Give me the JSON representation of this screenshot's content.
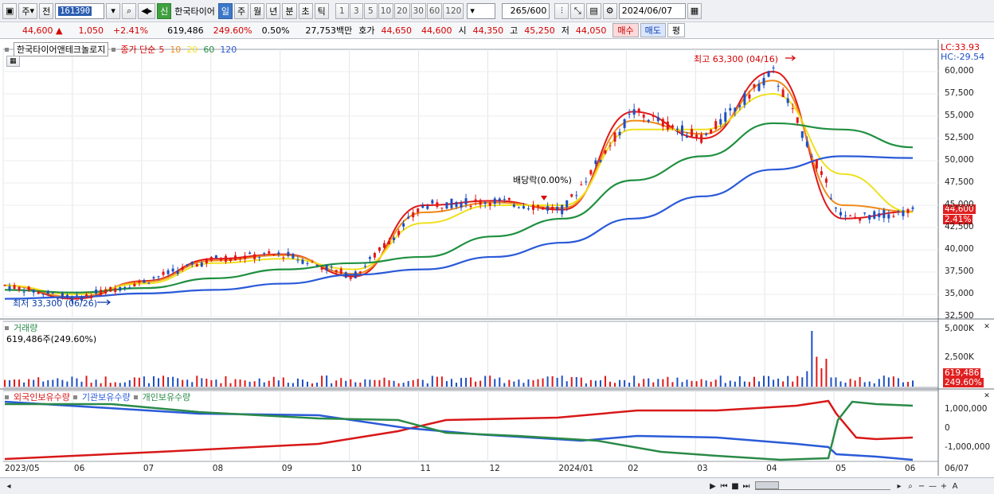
{
  "toolbar": {
    "period_unit": "주",
    "prev_label": "전",
    "code": "161390",
    "shin_label": "신",
    "stock_name": "한국타이어",
    "timeframes": [
      {
        "label": "일",
        "selected": true
      },
      {
        "label": "주",
        "selected": false
      },
      {
        "label": "월",
        "selected": false
      },
      {
        "label": "년",
        "selected": false
      },
      {
        "label": "분",
        "selected": false
      },
      {
        "label": "초",
        "selected": false
      },
      {
        "label": "틱",
        "selected": false
      }
    ],
    "intervals": [
      "1",
      "3",
      "5",
      "10",
      "20",
      "30",
      "60",
      "120"
    ],
    "count": "265",
    "count_total": "/600",
    "date": "2024/06/07"
  },
  "quote": {
    "price": "44,600",
    "change": "1,050",
    "change_pct": "+2.41%",
    "volume": "619,486",
    "vol_ratio": "249.60%",
    "turnover": "0.50%",
    "amount": "27,753백만",
    "ask_label": "호가",
    "ask": "44,650",
    "bid": "44,600",
    "open_label": "시",
    "open": "44,350",
    "high_label": "고",
    "high": "45,250",
    "low_label": "저",
    "low": "44,050",
    "buy_label": "매수",
    "sell_label": "매도",
    "avg_label": "평"
  },
  "legend": {
    "stock": "한국타이어앤테크놀로지",
    "ma_prefix": "종가 단순",
    "ma_periods": [
      "5",
      "10",
      "20",
      "60",
      "120"
    ],
    "ma_colors": [
      "#e01818",
      "#f08a1a",
      "#f0e020",
      "#209040",
      "#2a5ad8"
    ]
  },
  "annotations": {
    "high": "최고 63,300 (04/16)",
    "low": "최저 33,300 (06/26)",
    "dividend": "배당락(0.00%)",
    "lc": "LC:33.93",
    "hc": "HC:-29.54",
    "last_price_tag": "44,600",
    "last_pct_tag": "2.41%"
  },
  "volume_panel": {
    "title": "거래량",
    "value": "619,486주(249.60%)",
    "tag_value": "619,486",
    "tag_pct": "249.60%",
    "axis": [
      "5,000K",
      "2,500K",
      "0"
    ]
  },
  "holding_panel": {
    "legend": [
      "외국인보유수량",
      "기관보유수량",
      "개인보유수량"
    ],
    "colors": [
      "#d81818",
      "#2a5ad8",
      "#2a8a48"
    ],
    "axis": [
      "1,000,000",
      "0",
      "-1,000,000"
    ]
  },
  "x_axis": [
    "2023/05",
    "06",
    "07",
    "08",
    "09",
    "10",
    "11",
    "12",
    "2024/01",
    "02",
    "03",
    "04",
    "05",
    "06",
    "06/07"
  ],
  "y_axis": [
    "60,000",
    "57,500",
    "55,000",
    "52,500",
    "50,000",
    "47,500",
    "45,000",
    "42,500",
    "40,000",
    "37,500",
    "35,000",
    "32,500"
  ],
  "chart_data": {
    "type": "line",
    "ylim": [
      32500,
      62500
    ],
    "x": [
      "2023/05",
      "06",
      "07",
      "08",
      "09",
      "10",
      "11",
      "12",
      "2024/01",
      "02",
      "03",
      "04",
      "05",
      "06"
    ],
    "series": [
      {
        "name": "5",
        "values": [
          36000,
          34500,
          36500,
          39000,
          39500,
          37000,
          45000,
          45500,
          44500,
          55500,
          52500,
          60000,
          43500,
          44300
        ]
      },
      {
        "name": "10",
        "values": [
          36000,
          34700,
          36400,
          38800,
          39400,
          37300,
          44200,
          45300,
          44700,
          54500,
          53000,
          59000,
          45000,
          44300
        ]
      },
      {
        "name": "20",
        "values": [
          36000,
          35000,
          36200,
          38500,
          39000,
          37800,
          43000,
          45000,
          45000,
          53500,
          53500,
          57500,
          48500,
          44200
        ]
      },
      {
        "name": "60",
        "values": [
          35500,
          35200,
          35700,
          36800,
          37800,
          38500,
          39200,
          41500,
          43500,
          47800,
          50500,
          54200,
          53500,
          51500
        ]
      },
      {
        "name": "120",
        "values": [
          34500,
          34700,
          35100,
          35500,
          36200,
          37200,
          37800,
          39200,
          40800,
          43500,
          46000,
          49000,
          50500,
          50300
        ]
      }
    ]
  }
}
